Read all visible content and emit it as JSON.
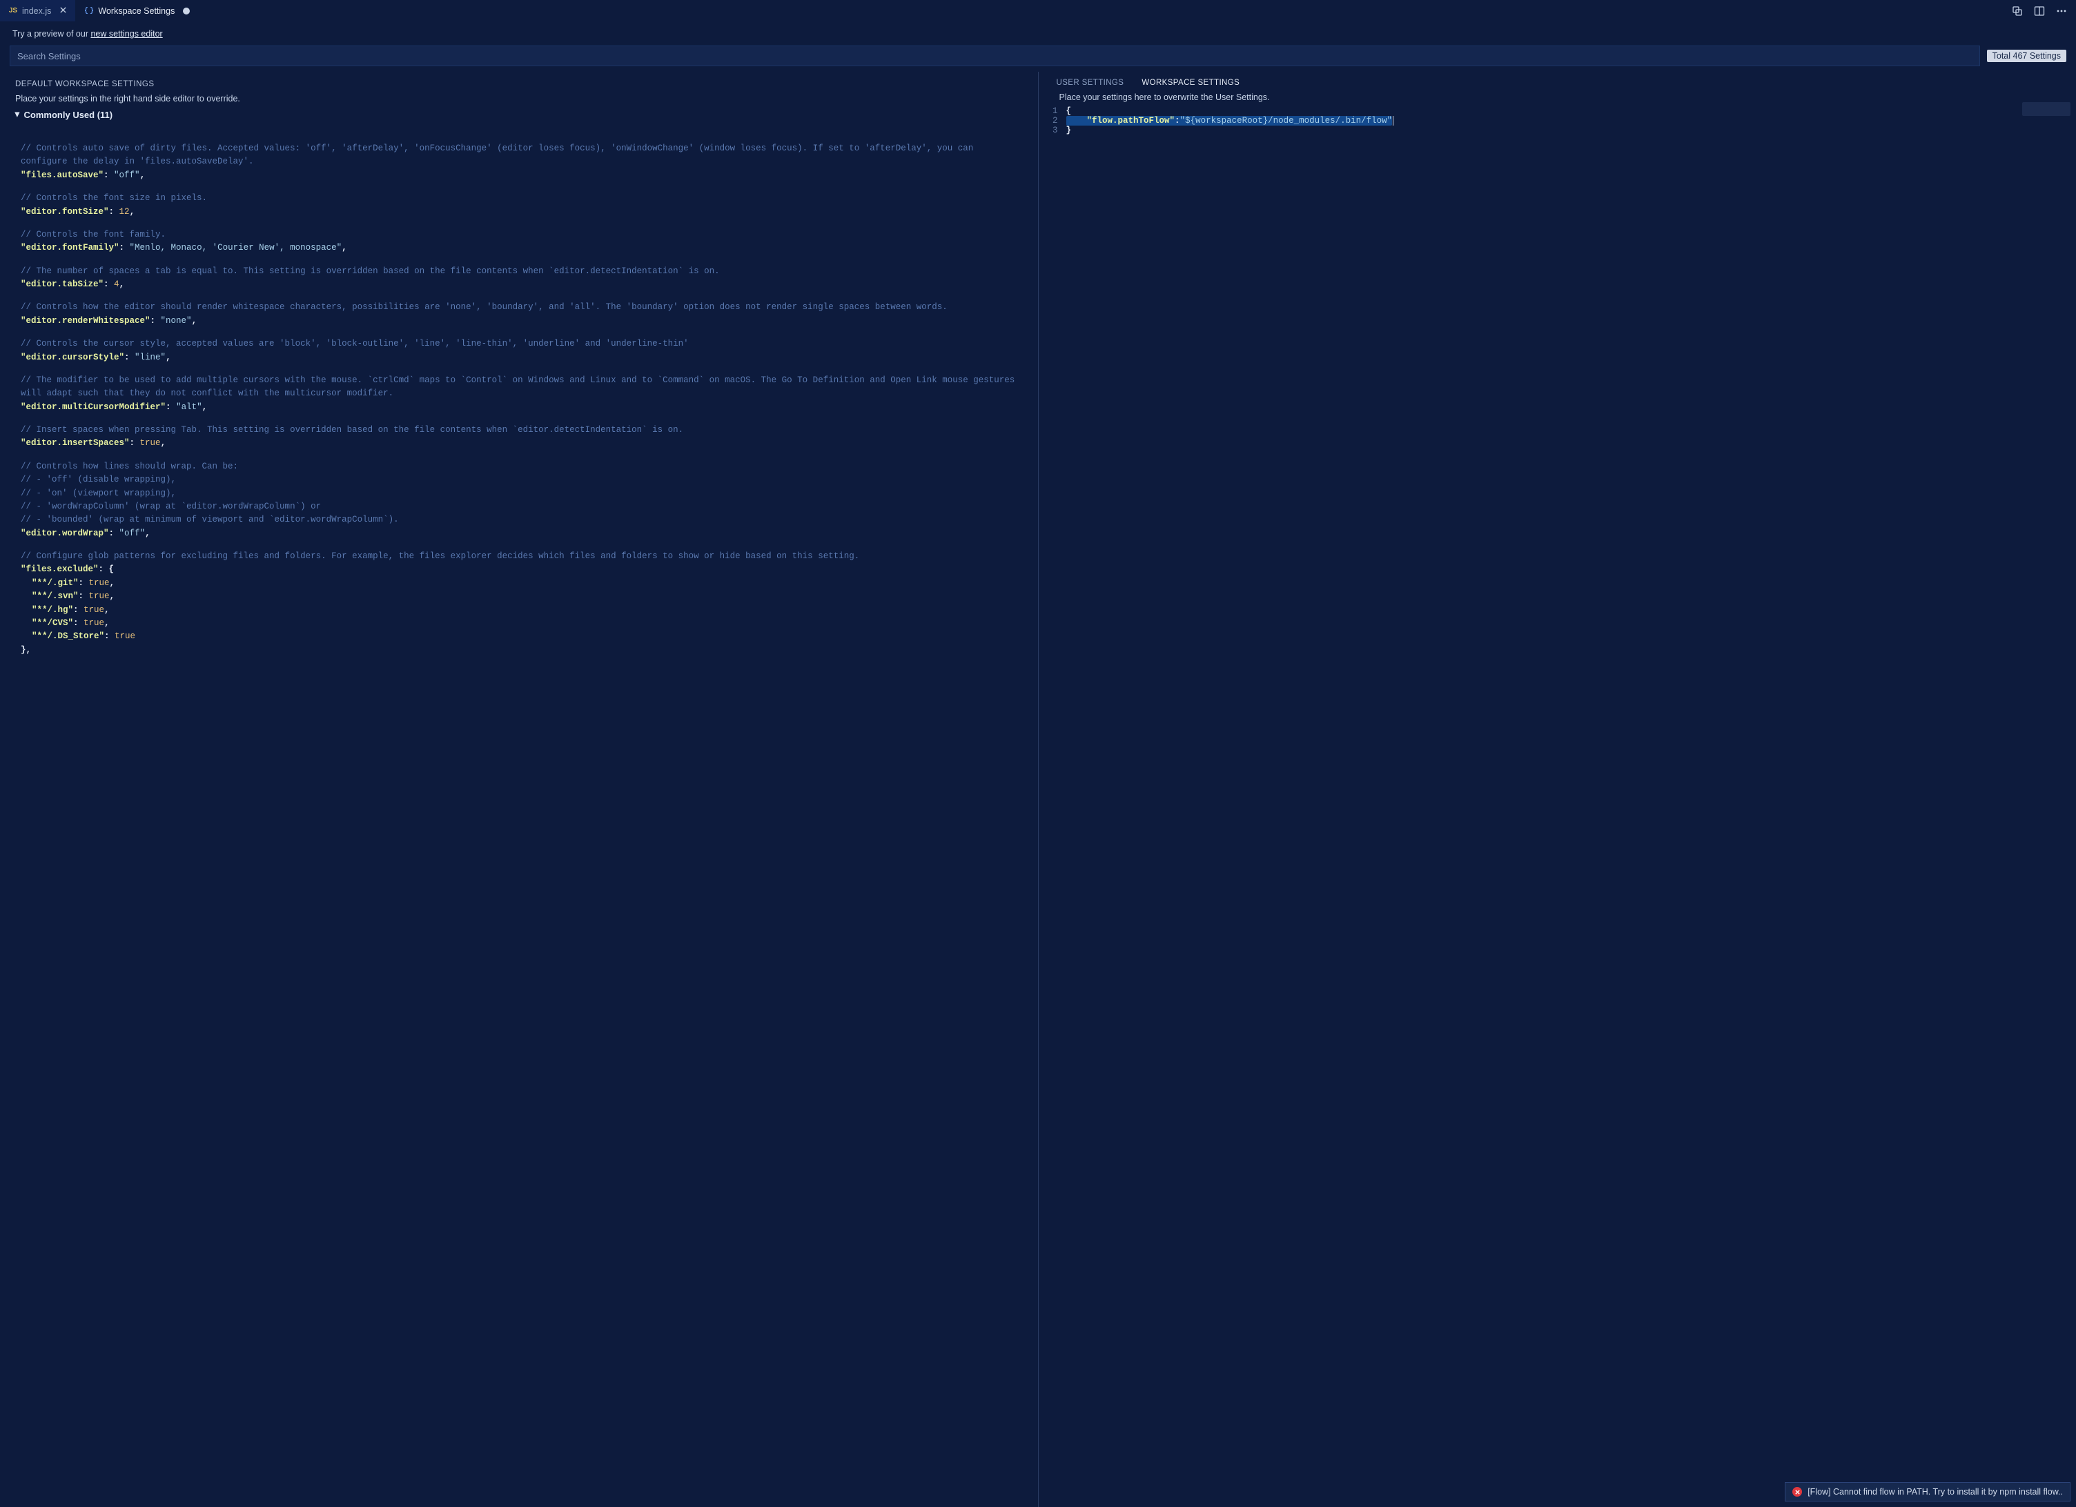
{
  "tabs": [
    {
      "label": "index.js",
      "iconName": "js-file-icon",
      "close": true,
      "dirty": false,
      "active": false
    },
    {
      "label": "Workspace Settings",
      "iconName": "braces-icon",
      "close": false,
      "dirty": true,
      "active": true
    }
  ],
  "banner": {
    "prefix": "Try a preview of our ",
    "link": "new settings editor"
  },
  "search": {
    "placeholder": "Search Settings",
    "total": "Total 467 Settings"
  },
  "left": {
    "header": "Default Workspace Settings",
    "hint": "Place your settings in the right hand side editor to override.",
    "group": "Commonly Used (11)",
    "items": [
      {
        "comment": "// Controls auto save of dirty files. Accepted values:  'off', 'afterDelay', 'onFocusChange' (editor loses focus), 'onWindowChange' (window loses focus). If set to 'afterDelay', you can configure the delay in 'files.autoSaveDelay'.",
        "key": "\"files.autoSave\"",
        "sep": ": ",
        "value": "\"off\"",
        "vclass": "val",
        "tail": ","
      },
      {
        "comment": "// Controls the font size in pixels.",
        "key": "\"editor.fontSize\"",
        "sep": ": ",
        "value": "12",
        "vclass": "num",
        "tail": ","
      },
      {
        "comment": "// Controls the font family.",
        "key": "\"editor.fontFamily\"",
        "sep": ": ",
        "value": "\"Menlo, Monaco, 'Courier New', monospace\"",
        "vclass": "val",
        "tail": ","
      },
      {
        "comment": "// The number of spaces a tab is equal to. This setting is overridden based on the file contents when `editor.detectIndentation` is on.",
        "key": "\"editor.tabSize\"",
        "sep": ": ",
        "value": "4",
        "vclass": "num",
        "tail": ","
      },
      {
        "comment": "// Controls how the editor should render whitespace characters, possibilities are 'none', 'boundary', and 'all'. The 'boundary' option does not render single spaces between words.",
        "key": "\"editor.renderWhitespace\"",
        "sep": ": ",
        "value": "\"none\"",
        "vclass": "val",
        "tail": ","
      },
      {
        "comment": "// Controls the cursor style, accepted values are 'block', 'block-outline', 'line', 'line-thin', 'underline' and 'underline-thin'",
        "key": "\"editor.cursorStyle\"",
        "sep": ": ",
        "value": "\"line\"",
        "vclass": "val",
        "tail": ","
      },
      {
        "comment": "// The modifier to be used to add multiple cursors with the mouse. `ctrlCmd` maps to `Control` on Windows and Linux and to `Command` on macOS. The Go To Definition and Open Link mouse gestures will adapt such that they do not conflict with the multicursor modifier.",
        "key": "\"editor.multiCursorModifier\"",
        "sep": ": ",
        "value": "\"alt\"",
        "vclass": "val",
        "tail": ","
      },
      {
        "comment": "// Insert spaces when pressing Tab. This setting is overridden based on the file contents when `editor.detectIndentation` is on.",
        "key": "\"editor.insertSpaces\"",
        "sep": ": ",
        "value": "true",
        "vclass": "bool",
        "tail": ","
      },
      {
        "comment": "// Controls how lines should wrap. Can be:\n//  - 'off' (disable wrapping),\n//  - 'on' (viewport wrapping),\n//  - 'wordWrapColumn' (wrap at `editor.wordWrapColumn`) or\n//  - 'bounded' (wrap at minimum of viewport and `editor.wordWrapColumn`).",
        "key": "\"editor.wordWrap\"",
        "sep": ": ",
        "value": "\"off\"",
        "vclass": "val",
        "tail": ","
      }
    ],
    "exclude": {
      "comment": "// Configure glob patterns for excluding files and folders. For example, the files explorer decides which files and folders to show or hide based on this setting.",
      "open": "\"files.exclude\": {",
      "rows": [
        {
          "k": "\"**/.git\"",
          "v": "true",
          "tail": ","
        },
        {
          "k": "\"**/.svn\"",
          "v": "true",
          "tail": ","
        },
        {
          "k": "\"**/.hg\"",
          "v": "true",
          "tail": ","
        },
        {
          "k": "\"**/CVS\"",
          "v": "true",
          "tail": ","
        },
        {
          "k": "\"**/.DS_Store\"",
          "v": "true",
          "tail": ""
        }
      ],
      "close": "},"
    }
  },
  "right": {
    "tabs": {
      "user": "User Settings",
      "workspace": "Workspace Settings"
    },
    "hint": "Place your settings here to overwrite the User Settings.",
    "lines": {
      "n1": "1",
      "n2": "2",
      "n3": "3",
      "l1": "{",
      "l2_indent": "    ",
      "l2_key": "\"flow.pathToFlow\"",
      "l2_colon": ":",
      "l2_val": "\"${workspaceRoot}/node_modules/.bin/flow\"",
      "l3": "}"
    }
  },
  "toast": {
    "text": "[Flow] Cannot find flow in PATH. Try to install it by npm install flow.."
  }
}
